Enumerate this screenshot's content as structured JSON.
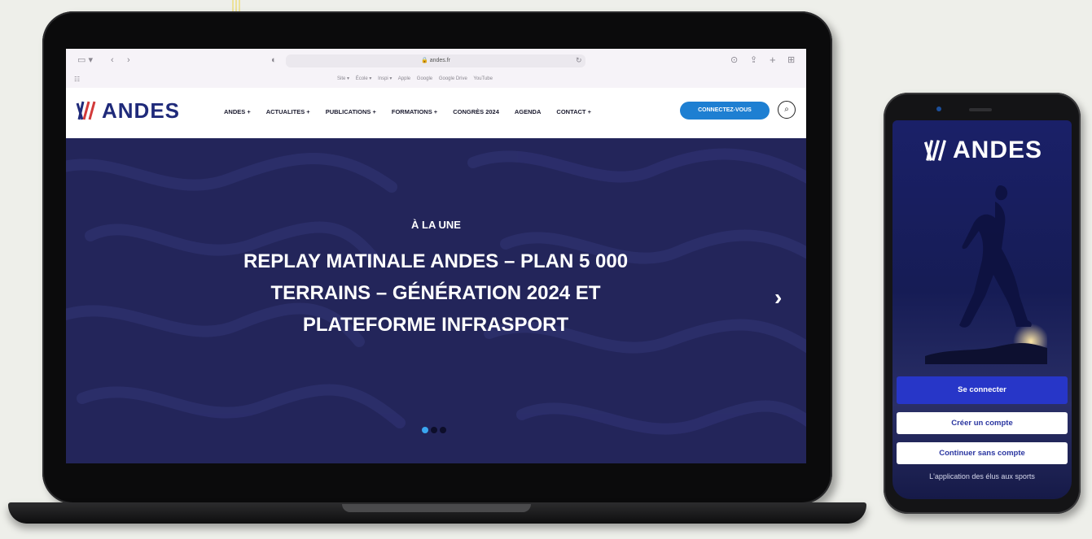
{
  "browser": {
    "url": "andes.fr",
    "bookmarks": [
      "Site ▾",
      "École ▾",
      "Inspi ▾",
      "Apple",
      "Google",
      "Google Drive",
      "YouTube"
    ]
  },
  "site": {
    "logo_text": "ANDES",
    "menu": [
      "ANDES +",
      "ACTUALITES +",
      "PUBLICATIONS +",
      "FORMATIONS +",
      "CONGRÈS 2024",
      "AGENDA",
      "CONTACT +"
    ],
    "cta_label": "CONNECTEZ-VOUS",
    "search_icon": "search-icon",
    "accent": "#1e7fd2",
    "hero_bg": "#23255a"
  },
  "hero": {
    "kicker": "À LA UNE",
    "headline": "REPLAY MATINALE ANDES – PLAN 5 000 TERRAINS – GÉNÉRATION 2024 ET PLATEFORME INFRASPORT",
    "slides_total": 3,
    "slide_active": 1
  },
  "app": {
    "logo_text": "ANDES",
    "primary_button": "Se connecter",
    "secondary_button": "Créer un compte",
    "tertiary_button": "Continuer sans compte",
    "tagline": "L'application des élus aux sports",
    "primary_color": "#2736c8"
  }
}
